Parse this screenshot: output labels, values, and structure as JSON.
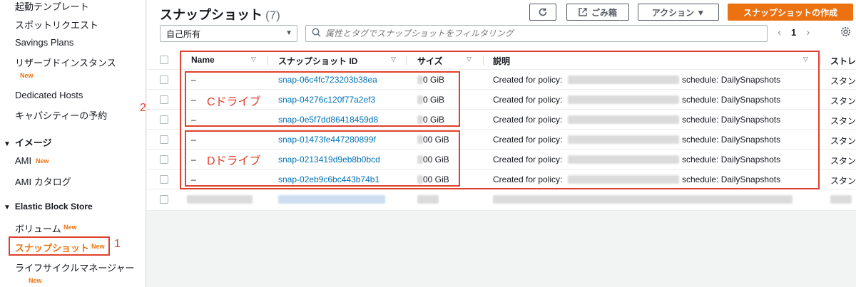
{
  "sidebar": {
    "launch_templates": "起動テンプレート",
    "spot_requests": "スポットリクエスト",
    "savings_plans": "Savings Plans",
    "reserved_instances": "リザーブドインスタンス",
    "dedicated_hosts": "Dedicated Hosts",
    "capacity_reservations": "キャパシティーの予約",
    "images_section": "イメージ",
    "ami": "AMI",
    "ami_catalog": "AMI カタログ",
    "ebs_section": "Elastic Block Store",
    "volumes": "ボリューム",
    "snapshots": "スナップショット",
    "lifecycle_manager": "ライフサイクルマネージャー",
    "new_badge": "New"
  },
  "annotations": {
    "one": "1",
    "two": "2",
    "c_drive": "Cドライブ",
    "d_drive": "Dドライブ"
  },
  "header": {
    "title": "スナップショット",
    "count": "(7)",
    "trash_label": "ごみ箱",
    "actions_label": "アクション ▼",
    "create_label": "スナップショットの作成"
  },
  "filters": {
    "owner": "自己所有",
    "search_placeholder": "属性とタグでスナップショットをフィルタリング",
    "page": "1"
  },
  "columns": {
    "name": "Name",
    "snapshot_id": "スナップショット ID",
    "size": "サイズ",
    "description": "説明",
    "storage": "ストレ"
  },
  "rows": [
    {
      "name": "–",
      "id": "snap-06c4fc723203b38ea",
      "size": "0 GiB",
      "desc_prefix": "Created for policy:",
      "desc_suffix": "schedule: DailySnapshots",
      "storage": "スタン"
    },
    {
      "name": "–",
      "id": "snap-04276c120f77a2ef3",
      "size": "0 GiB",
      "desc_prefix": "Created for policy:",
      "desc_suffix": "schedule: DailySnapshots",
      "storage": "スタン"
    },
    {
      "name": "–",
      "id": "snap-0e5f7dd86418459d8",
      "size": "0 GiB",
      "desc_prefix": "Created for policy:",
      "desc_suffix": "schedule: DailySnapshots",
      "storage": "スタン"
    },
    {
      "name": "–",
      "id": "snap-01473fe447280899f",
      "size": "00 GiB",
      "desc_prefix": "Created for policy:",
      "desc_suffix": "schedule: DailySnapshots",
      "storage": "スタン"
    },
    {
      "name": "–",
      "id": "snap-0213419d9eb8b0bcd",
      "size": "00 GiB",
      "desc_prefix": "Created for policy:",
      "desc_suffix": "schedule: DailySnapshots",
      "storage": "スタン"
    },
    {
      "name": "–",
      "id": "snap-02eb9c6bc443b74b1",
      "size": "00 GiB",
      "desc_prefix": "Created for policy:",
      "desc_suffix": "schedule: DailySnapshots",
      "storage": "スタン"
    }
  ],
  "colors": {
    "accent": "#ec7211",
    "link": "#0073bb",
    "annotation": "#e0412e"
  }
}
